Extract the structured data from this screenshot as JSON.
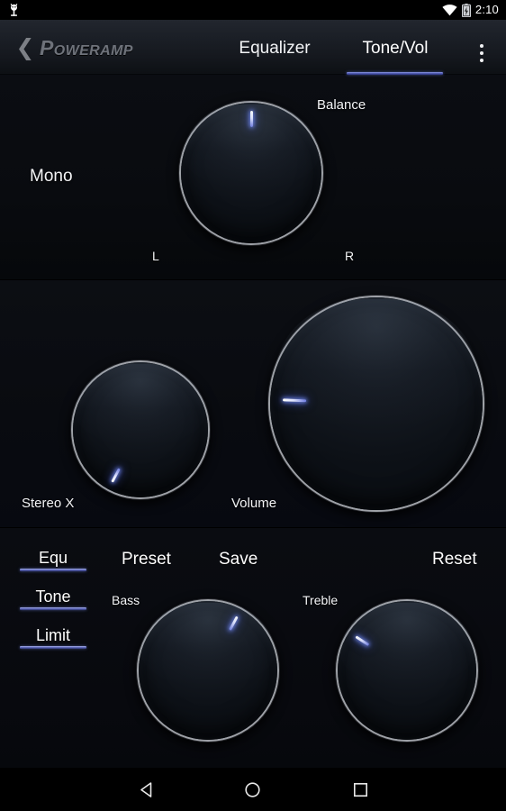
{
  "status_bar": {
    "notification_icon": "android-bug-icon",
    "wifi_icon": "wifi-icon",
    "battery_icon": "battery-charging-icon",
    "clock": "2:10"
  },
  "header": {
    "back_icon": "back-chevron-icon",
    "brand": "Poweramp",
    "overflow_icon": "overflow-menu-icon",
    "tabs": [
      {
        "label": "Equalizer",
        "active": false
      },
      {
        "label": "Tone/Vol",
        "active": true
      }
    ],
    "active_tab_underline_color": "#4a55ad"
  },
  "balance_panel": {
    "mono_label": "Mono",
    "balance_label": "Balance",
    "left_label": "L",
    "right_label": "R",
    "knob": {
      "name": "Balance",
      "angle_deg": 0,
      "value_pct": 50
    }
  },
  "volume_panel": {
    "stereo_x_label": "Stereo X",
    "volume_label": "Volume",
    "stereo_x_knob": {
      "name": "Stereo X",
      "angle_deg": 208,
      "value_pct": 8
    },
    "volume_knob": {
      "name": "Volume",
      "angle_deg": 272,
      "value_pct": 55
    }
  },
  "tone_panel": {
    "toggles": [
      {
        "label": "Equ",
        "active": true
      },
      {
        "label": "Tone",
        "active": true
      },
      {
        "label": "Limit",
        "active": true
      }
    ],
    "buttons": [
      {
        "label": "Preset"
      },
      {
        "label": "Save"
      },
      {
        "label": "Reset"
      }
    ],
    "bass_label": "Bass",
    "treble_label": "Treble",
    "bass_knob": {
      "name": "Bass",
      "angle_deg": 28,
      "value_pct": 58
    },
    "treble_knob": {
      "name": "Treble",
      "angle_deg": 303,
      "value_pct": 32
    }
  },
  "nav_bar": {
    "back_icon": "nav-back-triangle-icon",
    "home_icon": "nav-home-circle-icon",
    "recents_icon": "nav-recents-square-icon"
  },
  "colors": {
    "accent": "#4a55ad",
    "indicator": "#ffffff",
    "background": "#080a0e",
    "header_top": "#22262e"
  }
}
